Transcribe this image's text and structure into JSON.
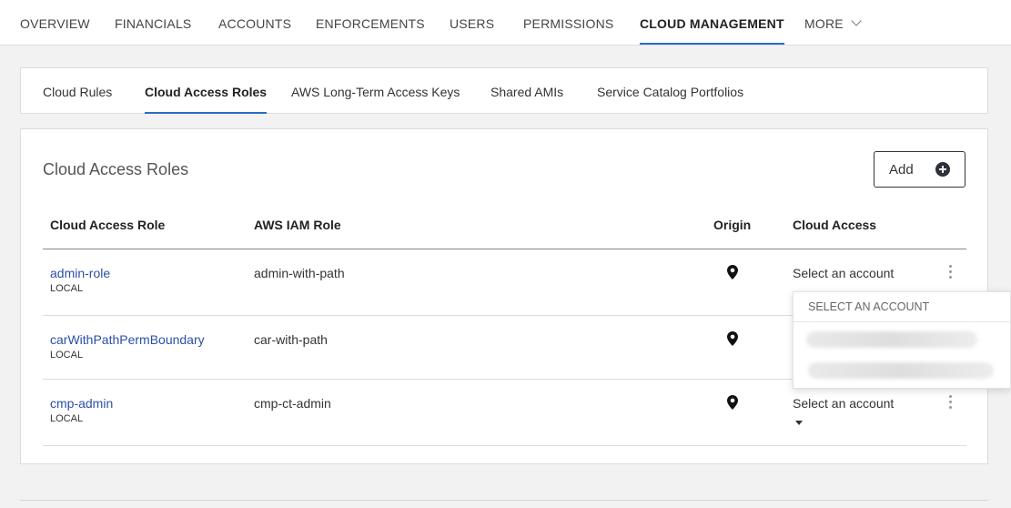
{
  "nav": {
    "items": [
      "OVERVIEW",
      "FINANCIALS",
      "ACCOUNTS",
      "ENFORCEMENTS",
      "USERS",
      "PERMISSIONS",
      "CLOUD MANAGEMENT",
      "MORE"
    ],
    "active": "CLOUD MANAGEMENT",
    "more_icon": "chevron-down-icon"
  },
  "subtabs": {
    "items": [
      "Cloud Rules",
      "Cloud Access Roles",
      "AWS Long-Term Access Keys",
      "Shared AMIs",
      "Service Catalog Portfolios"
    ],
    "active": "Cloud Access Roles"
  },
  "panel": {
    "title": "Cloud Access Roles",
    "add_label": "Add",
    "add_icon": "plus-circle-icon"
  },
  "table": {
    "headers": [
      "Cloud Access Role",
      "AWS IAM Role",
      "Origin",
      "Cloud Access"
    ],
    "rows": [
      {
        "role": "admin-role",
        "origin": "LOCAL",
        "iam": "admin-with-path",
        "origin_icon": "location-pin-icon",
        "cloud_access": "Select an account"
      },
      {
        "role": "carWithPathPermBoundary",
        "origin": "LOCAL",
        "iam": "car-with-path",
        "origin_icon": "location-pin-icon",
        "cloud_access": ""
      },
      {
        "role": "cmp-admin",
        "origin": "LOCAL",
        "iam": "cmp-ct-admin",
        "origin_icon": "location-pin-icon",
        "cloud_access": "Select an account"
      }
    ]
  },
  "dropdown": {
    "header": "SELECT AN ACCOUNT"
  },
  "colors": {
    "accent": "#2b6cc4",
    "link": "#2b4fa8",
    "page_bg": "#f2f2f2"
  }
}
